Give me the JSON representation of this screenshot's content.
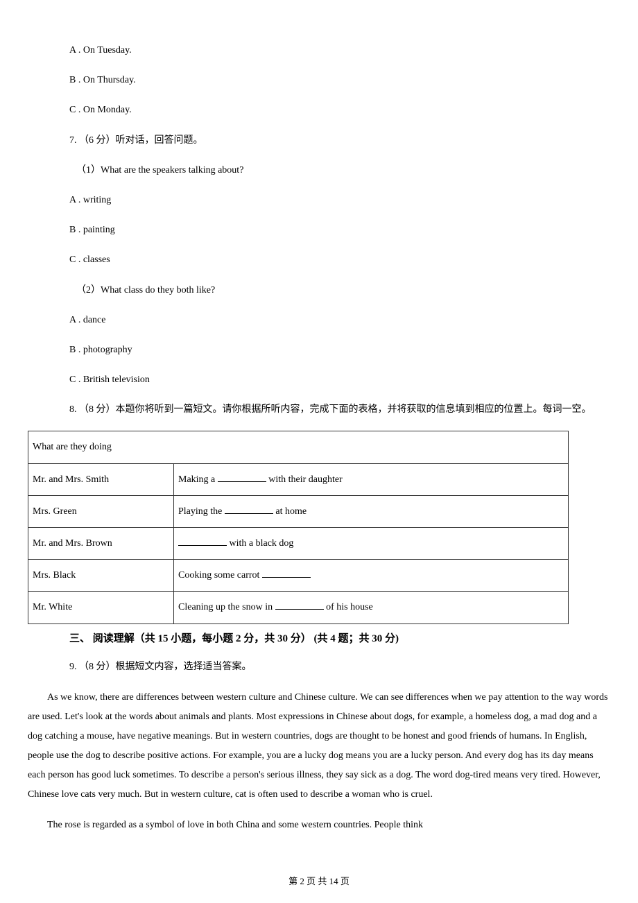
{
  "q6": {
    "optA": "A . On Tuesday.",
    "optB": "B . On Thursday.",
    "optC": "C . On Monday."
  },
  "q7": {
    "stem": "7. （6 分）听对话，回答问题。",
    "p1": "（1）What are the speakers talking about?",
    "p1A": "A . writing",
    "p1B": "B . painting",
    "p1C": "C . classes",
    "p2": "（2）What class do they both like?",
    "p2A": "A . dance",
    "p2B": "B . photography",
    "p2C": "C . British television"
  },
  "q8": {
    "stem": "8. （8 分）本题你将听到一篇短文。请你根据所听内容，完成下面的表格，并将获取的信息填到相应的位置上。每词一空。",
    "table": {
      "header": "What are they doing",
      "rows": [
        {
          "c1": "Mr. and Mrs. Smith",
          "c2a": "Making a ",
          "c2b": " with their daughter"
        },
        {
          "c1": "Mrs. Green",
          "c2a": "Playing the ",
          "c2b": " at home"
        },
        {
          "c1": "Mr. and Mrs. Brown",
          "c2a": "",
          "c2b": " with a black dog"
        },
        {
          "c1": "Mrs. Black",
          "c2a": "Cooking some carrot ",
          "c2b": ""
        },
        {
          "c1": "Mr. White",
          "c2a": "Cleaning up the snow in ",
          "c2b": " of his house"
        }
      ]
    }
  },
  "section3": "三、 阅读理解（共 15 小题，每小题 2 分，共 30 分） (共 4 题；共 30 分)",
  "q9": {
    "stem": "9. （8 分）根据短文内容，选择适当答案。",
    "para1": "As we know, there are differences between western culture and Chinese culture. We can see differences when we pay attention to the way words are used. Let's look at the words about animals and plants. Most expressions in Chinese about dogs, for example, a homeless dog, a mad dog and a dog catching a mouse, have negative meanings. But in western countries, dogs are thought to be honest and good friends of humans. In English, people use the dog to describe positive actions. For example, you are a lucky dog means you are a lucky person. And every dog has its day means each person has good luck sometimes. To describe a person's serious illness, they say sick as a dog. The word dog-tired means very tired. However, Chinese love cats very much. But in western culture, cat is often used to describe a woman who is cruel.",
    "para2": "The rose is regarded as a symbol of love in both China and some western countries. People think"
  },
  "footer": "第 2 页 共 14 页"
}
